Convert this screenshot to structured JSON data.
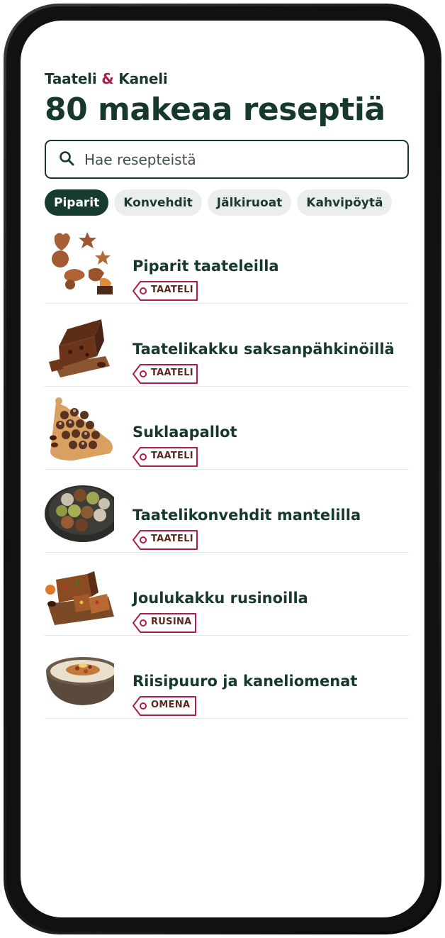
{
  "app": {
    "brand_part1": "Taateli",
    "brand_amp": "&",
    "brand_part2": "Kaneli"
  },
  "page_title": "80 makeaa reseptiä",
  "search": {
    "placeholder": "Hae resepteistä",
    "value": ""
  },
  "filters": [
    {
      "label": "Piparit",
      "active": true
    },
    {
      "label": "Konvehdit",
      "active": false
    },
    {
      "label": "Jälkiruoat",
      "active": false
    },
    {
      "label": "Kahvipöytä",
      "active": false
    }
  ],
  "recipes": [
    {
      "title": "Piparit taateleilla",
      "tag": "TAATELI",
      "image": "gingerbread-cookies"
    },
    {
      "title": "Taatelikakku saksanpähkinöillä",
      "tag": "TAATELI",
      "image": "date-cake"
    },
    {
      "title": "Suklaapallot",
      "tag": "TAATELI",
      "image": "chocolate-balls"
    },
    {
      "title": "Taatelikonvehdit mantelilla",
      "tag": "TAATELI",
      "image": "date-truffles"
    },
    {
      "title": "Joulukakku rusinoilla",
      "tag": "RUSINA",
      "image": "christmas-fruitcake"
    },
    {
      "title": "Riisipuuro ja kaneliomenat",
      "tag": "OMENA",
      "image": "rice-porridge"
    }
  ],
  "colors": {
    "primary": "#17392c",
    "accent": "#b01c4a",
    "chip_bg": "#eaeeec"
  }
}
